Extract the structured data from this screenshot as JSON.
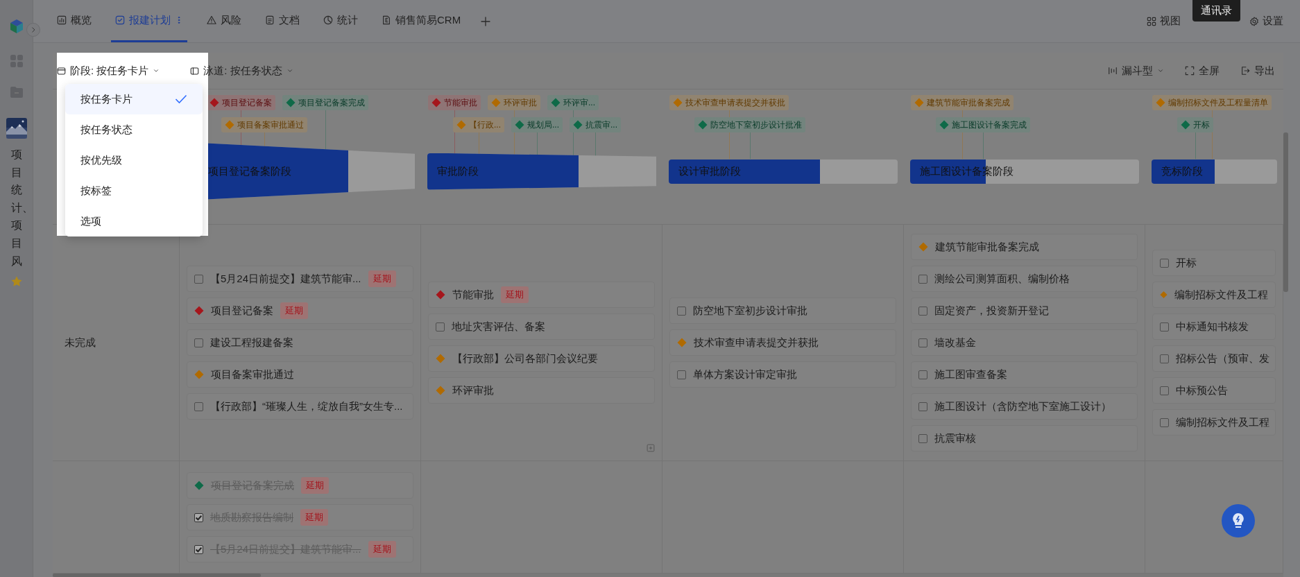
{
  "sidebar": {
    "vertical_title": "项目统计、项目风",
    "starred": true
  },
  "tabs": [
    {
      "label": "概览",
      "selected": false
    },
    {
      "label": "报建计划",
      "selected": true
    },
    {
      "label": "风险",
      "selected": false
    },
    {
      "label": "文档",
      "selected": false
    },
    {
      "label": "统计",
      "selected": false
    },
    {
      "label": "销售简易CRM",
      "selected": false
    }
  ],
  "header_actions": [
    {
      "label": "视图"
    },
    {
      "label": "设置"
    }
  ],
  "tooltip": "通讯录",
  "toolbar": {
    "stage_button": "阶段: 按任务卡片",
    "lane_button": "泳道: 按任务状态",
    "right": [
      {
        "label": "漏斗型",
        "dropdown": true
      },
      {
        "label": "全屏",
        "dropdown": false
      },
      {
        "label": "导出",
        "dropdown": false
      }
    ]
  },
  "stage_menu": [
    {
      "label": "按任务卡片",
      "selected": true
    },
    {
      "label": "按任务状态",
      "selected": false
    },
    {
      "label": "按优先级",
      "selected": false
    },
    {
      "label": "按标签",
      "selected": false
    },
    {
      "label": "选项",
      "selected": false
    }
  ],
  "stages": [
    {
      "name": "项目登记备案阶段",
      "level": 0.71,
      "milestones_top": [
        {
          "label": "项目登记备案",
          "color": "#a5161c"
        },
        {
          "label": "项目登记备案完成",
          "color": "#0e6a48"
        }
      ],
      "milestones_bottom": [
        {
          "label": "项目备案审批通过",
          "color": "#b06a00"
        }
      ]
    },
    {
      "name": "审批阶段",
      "level": 0.66,
      "milestones_top": [
        {
          "label": "节能审批",
          "color": "#a5161c"
        },
        {
          "label": "环评审批",
          "color": "#b06a00"
        },
        {
          "label": "环评审...",
          "color": "#0e6a48"
        }
      ],
      "milestones_bottom": [
        {
          "label": "【行政...",
          "color": "#b06a00"
        },
        {
          "label": "规划局...",
          "color": "#0e6a48"
        },
        {
          "label": "抗震审...",
          "color": "#0e6a48"
        }
      ]
    },
    {
      "name": "设计审批阶段",
      "level": 0.66,
      "milestones_top": [
        {
          "label": "技术审查申请表提交并获批",
          "color": "#b06a00"
        }
      ],
      "milestones_bottom": [
        {
          "label": "防空地下室初步设计批准",
          "color": "#0e6a48"
        }
      ]
    },
    {
      "name": "施工图设计备案阶段",
      "level": 0.33,
      "milestones_top": [
        {
          "label": "建筑节能审批备案完成",
          "color": "#b06a00"
        }
      ],
      "milestones_bottom": [
        {
          "label": "施工图设计备案完成",
          "color": "#0e6a48"
        }
      ]
    },
    {
      "name": "竞标阶段",
      "level": 0.5,
      "milestones_top": [
        {
          "label": "编制招标文件及工程量清单",
          "color": "#b06a00"
        }
      ],
      "milestones_bottom": [
        {
          "label": "开标",
          "color": "#0e6a48"
        }
      ]
    }
  ],
  "lanes": [
    {
      "name": "未完成",
      "cells": [
        {
          "items": [
            {
              "kind": "task",
              "title": "【5月24日前提交】建筑节能审...",
              "done": false,
              "badge": "延期"
            },
            {
              "kind": "milestone",
              "title": "项目登记备案",
              "done": false,
              "badge": "延期",
              "color": "#a5161c"
            },
            {
              "kind": "task",
              "title": "建设工程报建备案",
              "done": false
            },
            {
              "kind": "milestone",
              "title": "项目备案审批通过",
              "done": false,
              "color": "#b06a00"
            },
            {
              "kind": "task",
              "title": "【行政部】“璀璨人生，绽放自我”女生专...",
              "done": false
            }
          ]
        },
        {
          "add_button": true,
          "items": [
            {
              "kind": "milestone",
              "title": "节能审批",
              "done": false,
              "badge": "延期",
              "color": "#a5161c"
            },
            {
              "kind": "task",
              "title": "地址灾害评估、备案",
              "done": false
            },
            {
              "kind": "milestone",
              "title": "【行政部】公司各部门会议纪要",
              "done": false,
              "color": "#b06a00"
            },
            {
              "kind": "milestone",
              "title": "环评审批",
              "done": false,
              "color": "#b06a00"
            }
          ]
        },
        {
          "items": [
            {
              "kind": "task",
              "title": "防空地下室初步设计审批",
              "done": false
            },
            {
              "kind": "milestone",
              "title": "技术审查申请表提交并获批",
              "done": false,
              "color": "#b06a00"
            },
            {
              "kind": "task",
              "title": "单体方案设计审定审批",
              "done": false
            }
          ]
        },
        {
          "items": [
            {
              "kind": "milestone",
              "title": "建筑节能审批备案完成",
              "done": false,
              "color": "#b06a00"
            },
            {
              "kind": "task",
              "title": "测绘公司测算面积、编制价格",
              "done": false
            },
            {
              "kind": "task",
              "title": "固定资产，投资新开登记",
              "done": false
            },
            {
              "kind": "task",
              "title": "墙改基金",
              "done": false
            },
            {
              "kind": "task",
              "title": "施工图审查备案",
              "done": false
            },
            {
              "kind": "task",
              "title": "施工图设计（含防空地下室施工设计）",
              "done": false
            },
            {
              "kind": "task",
              "title": "抗震审核",
              "done": false
            }
          ]
        },
        {
          "items": [
            {
              "kind": "task",
              "title": "开标",
              "done": false
            },
            {
              "kind": "milestone",
              "title": "编制招标文件及工程",
              "done": false,
              "color": "#b06a00"
            },
            {
              "kind": "task",
              "title": "中标通知书核发",
              "done": false
            },
            {
              "kind": "task",
              "title": "招标公告（预审、发",
              "done": false
            },
            {
              "kind": "task",
              "title": "中标预公告",
              "done": false
            },
            {
              "kind": "task",
              "title": "编制招标文件及工程",
              "done": false
            }
          ]
        }
      ]
    },
    {
      "cells": [
        {
          "items": [
            {
              "kind": "milestone",
              "title": "项目登记备案完成",
              "done": true,
              "badge": "延期",
              "color": "#0e6a48"
            },
            {
              "kind": "task",
              "title": "地质勘察报告编制",
              "done": true,
              "badge": "延期"
            },
            {
              "kind": "task",
              "title": "【5月24日前提交】建筑节能审...",
              "done": true,
              "badge": "延期"
            }
          ]
        },
        {},
        {},
        {},
        {}
      ]
    }
  ]
}
